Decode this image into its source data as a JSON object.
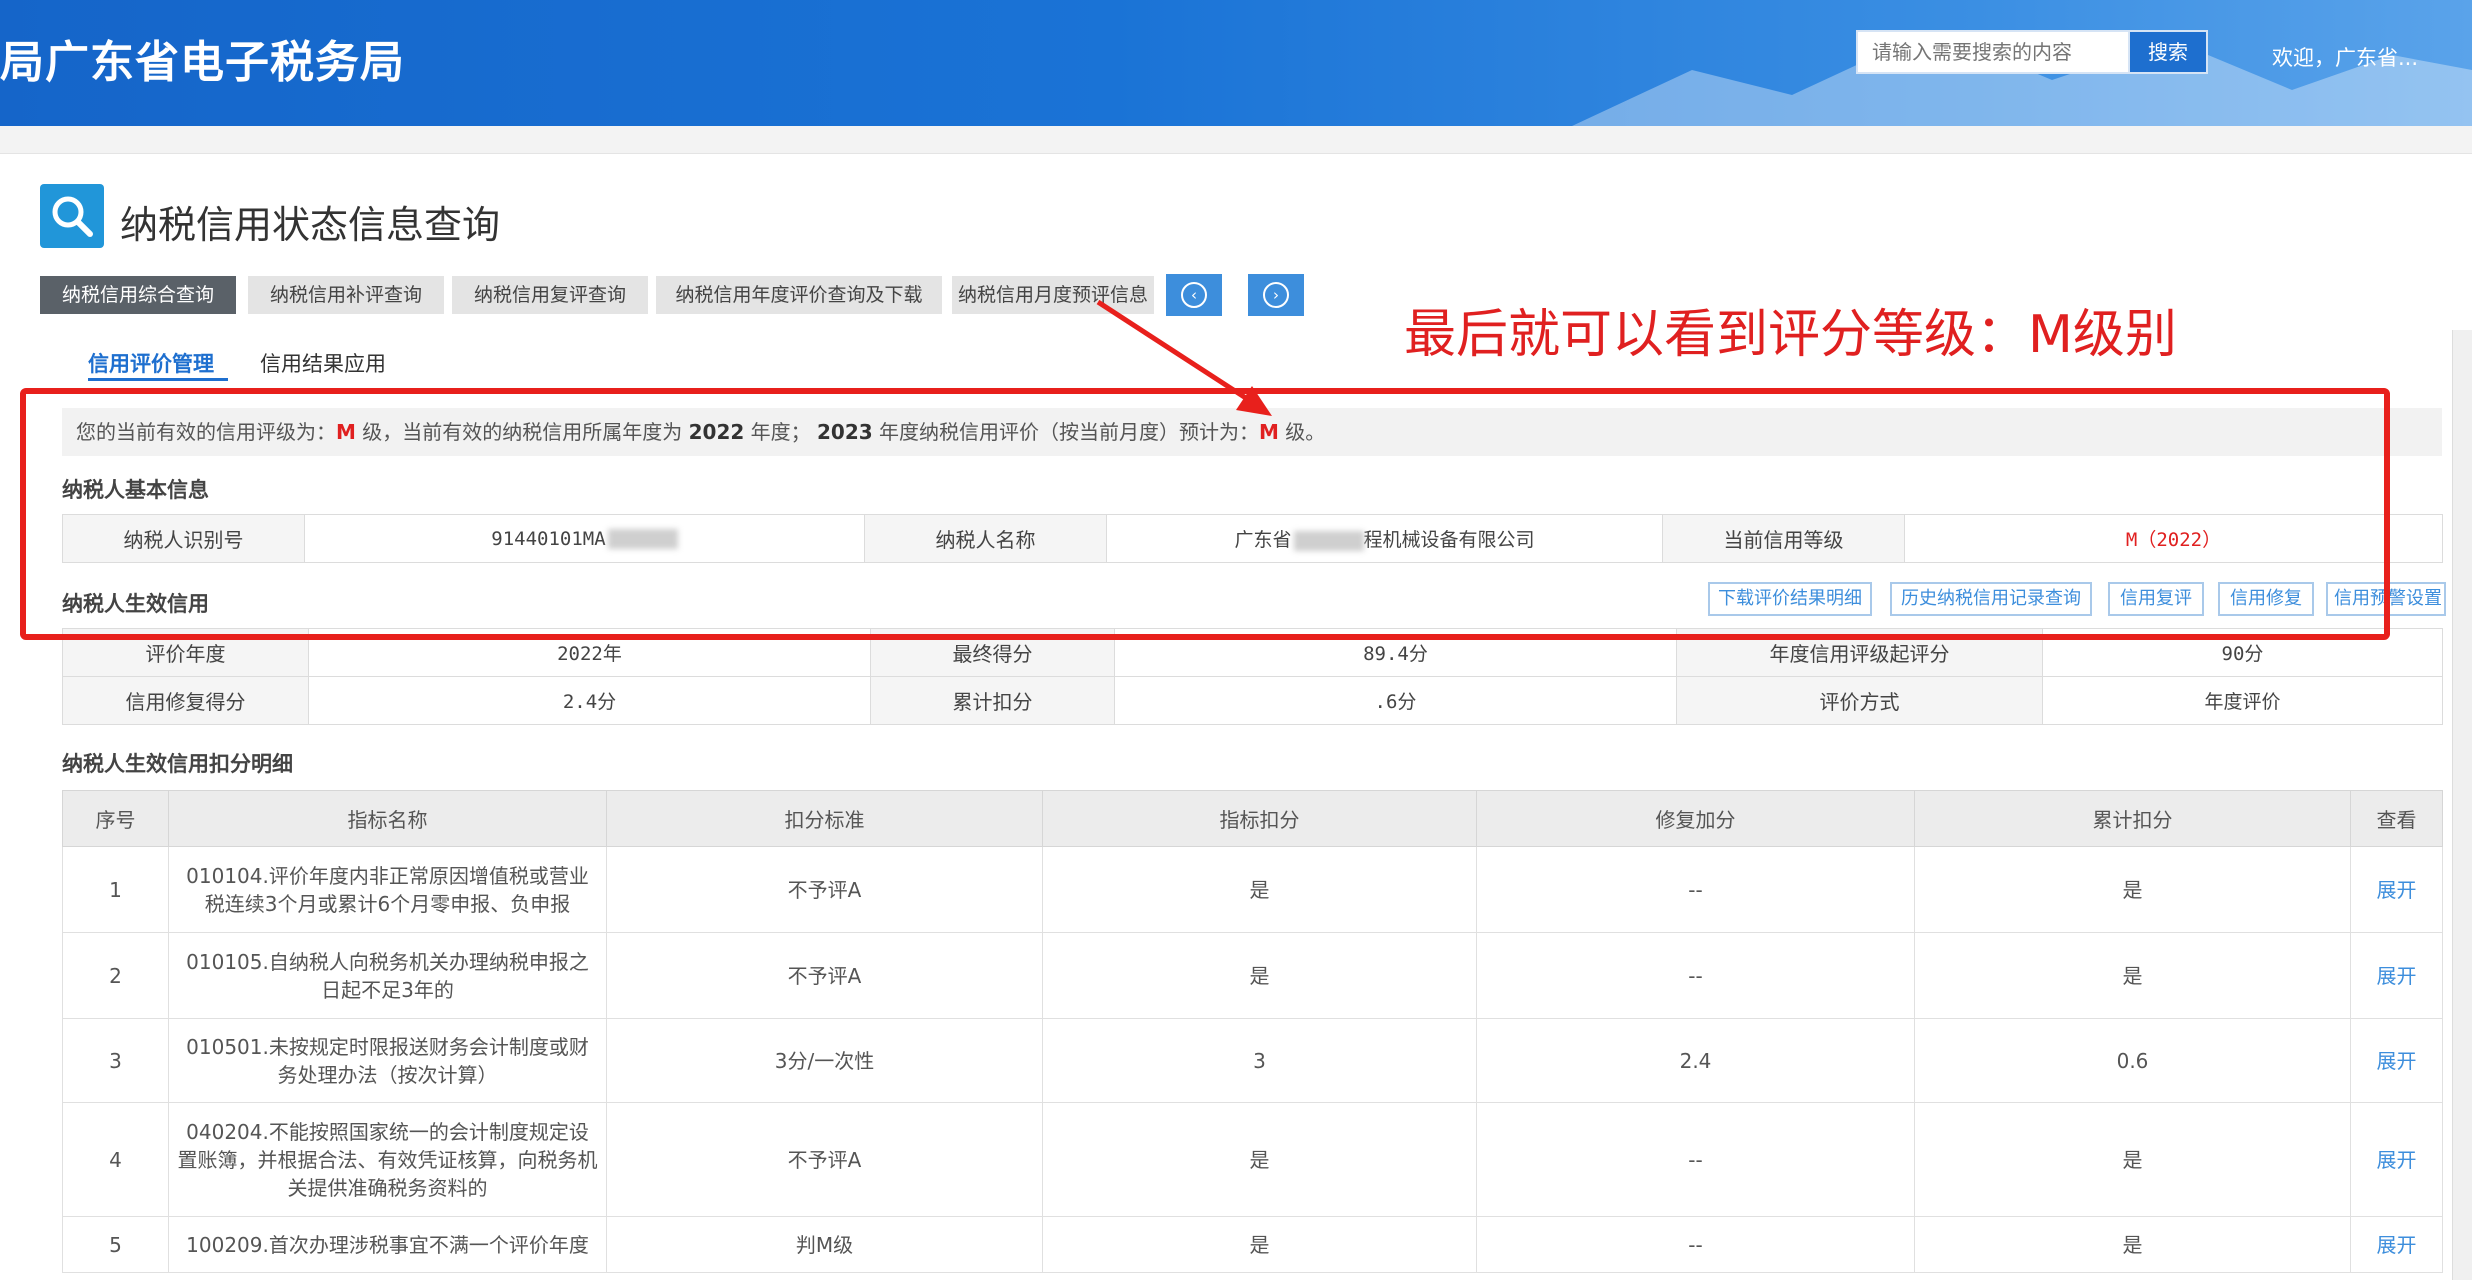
{
  "header": {
    "brand": "局广东省电子税务局",
    "search_placeholder": "请输入需要搜索的内容",
    "search_button": "搜索",
    "welcome": "欢迎，广东省..."
  },
  "page_title": "纳税信用状态信息查询",
  "tabs": [
    {
      "label": "纳税信用综合查询",
      "active": true
    },
    {
      "label": "纳税信用补评查询",
      "active": false
    },
    {
      "label": "纳税信用复评查询",
      "active": false
    },
    {
      "label": "纳税信用年度评价查询及下载",
      "active": false
    },
    {
      "label": "纳税信用月度预评信息",
      "active": false
    }
  ],
  "annotation": "最后就可以看到评分等级：M级别",
  "subtabs": [
    {
      "label": "信用评价管理",
      "active": true
    },
    {
      "label": "信用结果应用",
      "active": false
    }
  ],
  "notice": {
    "p1": "您的当前有效的信用评级为：",
    "grade": "M",
    "p2": " 级，当前有效的纳税信用所属年度为 ",
    "year": "2022",
    "p3": " 年度； ",
    "year2": "2023",
    "p4": " 年度纳税信用评价（按当前月度）预计为：",
    "grade2": "M",
    "p5": " 级。"
  },
  "basic_info": {
    "title": "纳税人基本信息",
    "id_label": "纳税人识别号",
    "id_value": "91440101MA",
    "name_label": "纳税人名称",
    "name_value_a": "广东省",
    "name_value_b": "程机械设备有限公司",
    "level_label": "当前信用等级",
    "level_value": "M（2022）"
  },
  "effective_credit": {
    "title": "纳税人生效信用",
    "buttons": [
      "下载评价结果明细",
      "历史纳税信用记录查询",
      "信用复评",
      "信用修复",
      "信用预警设置"
    ],
    "rows": [
      [
        "评价年度",
        "2022年",
        "最终得分",
        "89.4分",
        "年度信用评级起评分",
        "90分"
      ],
      [
        "信用修复得分",
        "2.4分",
        "累计扣分",
        ".6分",
        "评价方式",
        "年度评价"
      ]
    ]
  },
  "deduction_detail": {
    "title": "纳税人生效信用扣分明细",
    "headers": [
      "序号",
      "指标名称",
      "扣分标准",
      "指标扣分",
      "修复加分",
      "累计扣分",
      "查看"
    ],
    "rows": [
      [
        "1",
        "010104.评价年度内非正常原因增值税或营业税连续3个月或累计6个月零申报、负申报",
        "不予评A",
        "是",
        "--",
        "是",
        "展开"
      ],
      [
        "2",
        "010105.自纳税人向税务机关办理纳税申报之日起不足3年的",
        "不予评A",
        "是",
        "--",
        "是",
        "展开"
      ],
      [
        "3",
        "010501.未按规定时限报送财务会计制度或财务处理办法（按次计算）",
        "3分/一次性",
        "3",
        "2.4",
        "0.6",
        "展开"
      ],
      [
        "4",
        "040204.不能按照国家统一的会计制度规定设置账簿，并根据合法、有效凭证核算，向税务机关提供准确税务资料的",
        "不予评A",
        "是",
        "--",
        "是",
        "展开"
      ],
      [
        "5",
        "100209.首次办理涉税事宜不满一个评价年度",
        "判M级",
        "是",
        "--",
        "是",
        "展开"
      ]
    ]
  },
  "colors": {
    "header_blue": "#1a73d6",
    "accent_red": "#e02020",
    "link_blue": "#3d8edc",
    "active_tab": "#5a6168"
  }
}
